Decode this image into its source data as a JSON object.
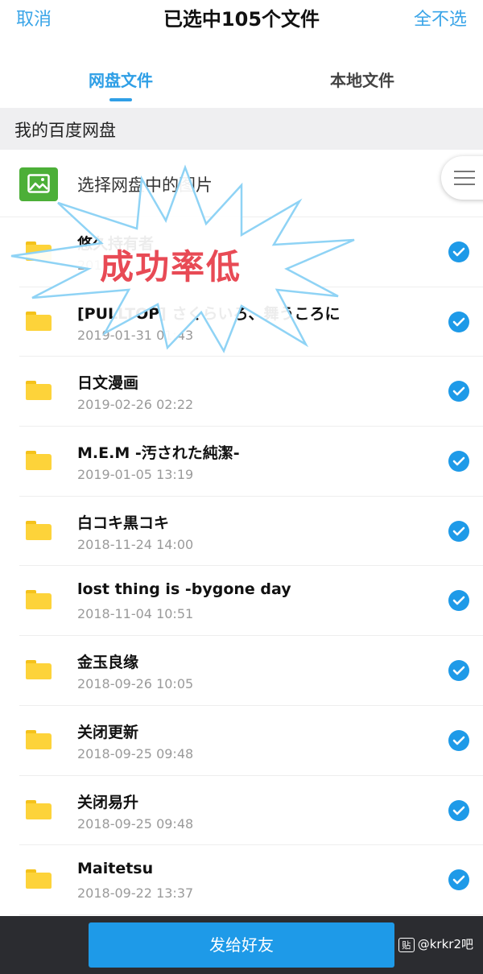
{
  "header": {
    "cancel_label": "取消",
    "title": "已选中105个文件",
    "deselect_all_label": "全不选"
  },
  "tabs": [
    {
      "label": "网盘文件",
      "active": true
    },
    {
      "label": "本地文件",
      "active": false
    }
  ],
  "section": {
    "title": "我的百度网盘"
  },
  "pick_images": {
    "label": "选择网盘中的图片",
    "icon": "image-icon"
  },
  "overlay": {
    "text": "成功率低"
  },
  "files": [
    {
      "name": "悠久持有者",
      "date": "2019-",
      "selected": true
    },
    {
      "name": "[PULLTOP] さくらいろ、舞うころに",
      "date": "2019-01-31 01:43",
      "selected": true
    },
    {
      "name": "日文漫画",
      "date": "2019-02-26 02:22",
      "selected": true
    },
    {
      "name": "M.E.M -汚された純潔-",
      "date": "2019-01-05 13:19",
      "selected": true
    },
    {
      "name": "白コキ黒コキ",
      "date": "2018-11-24 14:00",
      "selected": true
    },
    {
      "name": "lost thing is -bygone day",
      "date": "2018-11-04 10:51",
      "selected": true
    },
    {
      "name": "金玉良缘",
      "date": "2018-09-26 10:05",
      "selected": true
    },
    {
      "name": "关闭更新",
      "date": "2018-09-25 09:48",
      "selected": true
    },
    {
      "name": "关闭易升",
      "date": "2018-09-25 09:48",
      "selected": true
    },
    {
      "name": "Maitetsu",
      "date": "2018-09-22 13:37",
      "selected": true
    }
  ],
  "bottom": {
    "send_label": "发给好友",
    "watermark": "@krkr2吧",
    "watermark_icon_text": "贴"
  },
  "colors": {
    "accent": "#1e9ae8",
    "folder": "#fdd33a",
    "image_icon": "#4caf38",
    "overlay_text": "#e84a55",
    "burst_fill": "#ffffff",
    "burst_stroke": "#8fd3f5"
  }
}
